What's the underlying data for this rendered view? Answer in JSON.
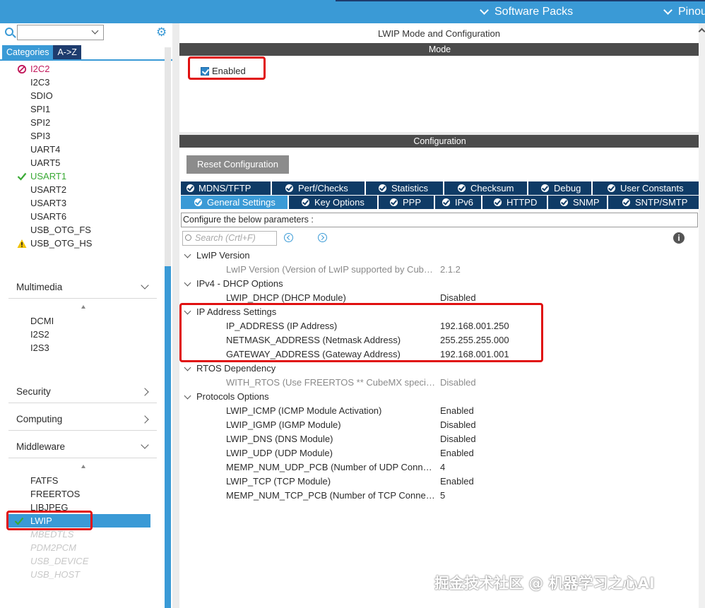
{
  "topbar": {
    "software_packs": "Software Packs",
    "pinout": "Pinou"
  },
  "left": {
    "tabs": {
      "categories": "Categories",
      "az": "A->Z"
    },
    "connectivity_items": [
      {
        "label": "I2C2",
        "status": "disabled"
      },
      {
        "label": "I2C3",
        "status": "none"
      },
      {
        "label": "SDIO",
        "status": "none"
      },
      {
        "label": "SPI1",
        "status": "none"
      },
      {
        "label": "SPI2",
        "status": "none"
      },
      {
        "label": "SPI3",
        "status": "none"
      },
      {
        "label": "UART4",
        "status": "none"
      },
      {
        "label": "UART5",
        "status": "none"
      },
      {
        "label": "USART1",
        "status": "enabled"
      },
      {
        "label": "USART2",
        "status": "none"
      },
      {
        "label": "USART3",
        "status": "none"
      },
      {
        "label": "USART6",
        "status": "none"
      },
      {
        "label": "USB_OTG_FS",
        "status": "none"
      },
      {
        "label": "USB_OTG_HS",
        "status": "warning"
      }
    ],
    "categories": {
      "multimedia": "Multimedia",
      "security": "Security",
      "computing": "Computing",
      "middleware": "Middleware"
    },
    "multimedia_items": [
      "DCMI",
      "I2S2",
      "I2S3"
    ],
    "middleware_items": [
      {
        "label": "FATFS",
        "state": "normal"
      },
      {
        "label": "FREERTOS",
        "state": "normal"
      },
      {
        "label": "LIBJPEG",
        "state": "normal"
      },
      {
        "label": "LWIP",
        "state": "selected"
      },
      {
        "label": "MBEDTLS",
        "state": "unavailable"
      },
      {
        "label": "PDM2PCM",
        "state": "unavailable"
      },
      {
        "label": "USB_DEVICE",
        "state": "unavailable"
      },
      {
        "label": "USB_HOST",
        "state": "unavailable"
      }
    ]
  },
  "right": {
    "title": "LWIP Mode and Configuration",
    "mode_header": "Mode",
    "enabled_label": "Enabled",
    "config_header": "Configuration",
    "reset_button": "Reset Configuration",
    "tabs_row1": [
      "MDNS/TFTP",
      "Perf/Checks",
      "Statistics",
      "Checksum",
      "Debug",
      "User Constants"
    ],
    "tabs_row2": [
      "General Settings",
      "Key Options",
      "PPP",
      "IPv6",
      "HTTPD",
      "SNMP",
      "SNTP/SMTP"
    ],
    "hint": "Configure the below parameters :",
    "search_placeholder": "Search (Crtl+F)",
    "groups": {
      "lwip_version": "LwIP Version",
      "ipv4_dhcp": "IPv4 - DHCP Options",
      "ip_address": "IP Address Settings",
      "rtos": "RTOS Dependency",
      "protocols": "Protocols Options"
    },
    "params": {
      "lwip_version": {
        "name": "LwIP Version (Version of LwIP supported by CubeMX)",
        "value": "2.1.2"
      },
      "lwip_dhcp": {
        "name": "LWIP_DHCP (DHCP Module)",
        "value": "Disabled"
      },
      "ip_address": {
        "name": "IP_ADDRESS (IP Address)",
        "value": "192.168.001.250"
      },
      "netmask": {
        "name": "NETMASK_ADDRESS (Netmask Address)",
        "value": "255.255.255.000"
      },
      "gateway": {
        "name": "GATEWAY_ADDRESS (Gateway Address)",
        "value": "192.168.001.001"
      },
      "with_rtos": {
        "name": "WITH_RTOS (Use FREERTOS ** CubeMX specific **)",
        "value": "Disabled"
      },
      "lwip_icmp": {
        "name": "LWIP_ICMP (ICMP Module Activation)",
        "value": "Enabled"
      },
      "lwip_igmp": {
        "name": "LWIP_IGMP (IGMP Module)",
        "value": "Disabled"
      },
      "lwip_dns": {
        "name": "LWIP_DNS (DNS Module)",
        "value": "Disabled"
      },
      "lwip_udp": {
        "name": "LWIP_UDP (UDP Module)",
        "value": "Enabled"
      },
      "memp_udp": {
        "name": "MEMP_NUM_UDP_PCB (Number of UDP Connections)",
        "value": "4"
      },
      "lwip_tcp": {
        "name": "LWIP_TCP (TCP Module)",
        "value": "Enabled"
      },
      "memp_tcp": {
        "name": "MEMP_NUM_TCP_PCB (Number of TCP Connections)",
        "value": "5"
      }
    }
  },
  "watermark": "掘金技术社区 @ 机器学习之心AI",
  "colors": {
    "accent": "#3a9ad6",
    "dark_tab": "#0f3b66",
    "highlight": "#e01010",
    "enabled_green": "#3aaa35",
    "disabled_magenta": "#c2185b"
  }
}
